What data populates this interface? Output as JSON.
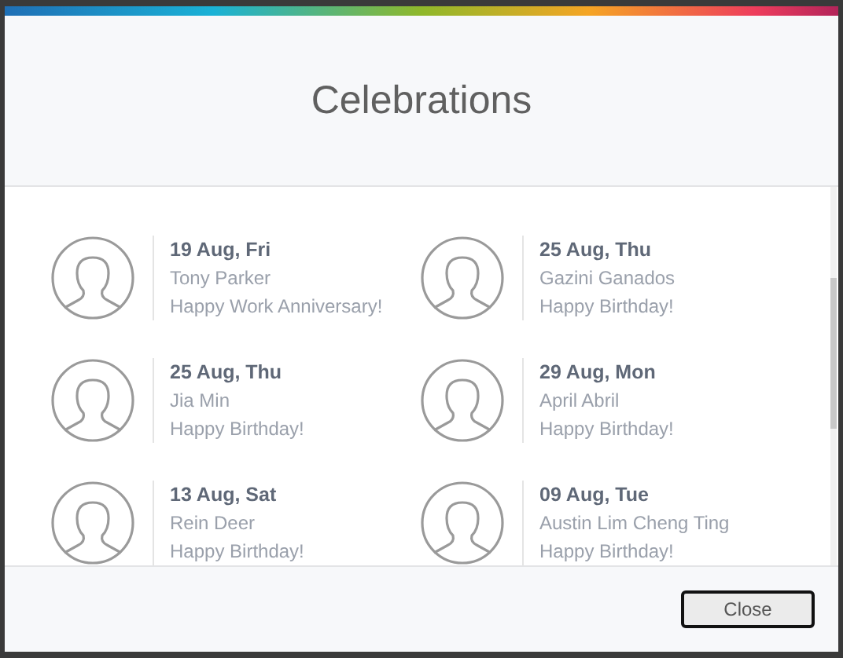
{
  "dialog": {
    "title": "Celebrations"
  },
  "celebrations": [
    {
      "date": "19 Aug, Fri",
      "name": "Tony Parker",
      "message": "Happy Work Anniversary!"
    },
    {
      "date": "25 Aug, Thu",
      "name": "Gazini Ganados",
      "message": "Happy Birthday!"
    },
    {
      "date": "25 Aug, Thu",
      "name": "Jia Min",
      "message": "Happy Birthday!"
    },
    {
      "date": "29 Aug, Mon",
      "name": "April Abril",
      "message": "Happy Birthday!"
    },
    {
      "date": "13 Aug, Sat",
      "name": "Rein Deer",
      "message": "Happy Birthday!"
    },
    {
      "date": "09 Aug, Tue",
      "name": "Austin Lim Cheng Ting",
      "message": "Happy Birthday!"
    }
  ],
  "buttons": [
    {
      "label": "Close"
    }
  ]
}
